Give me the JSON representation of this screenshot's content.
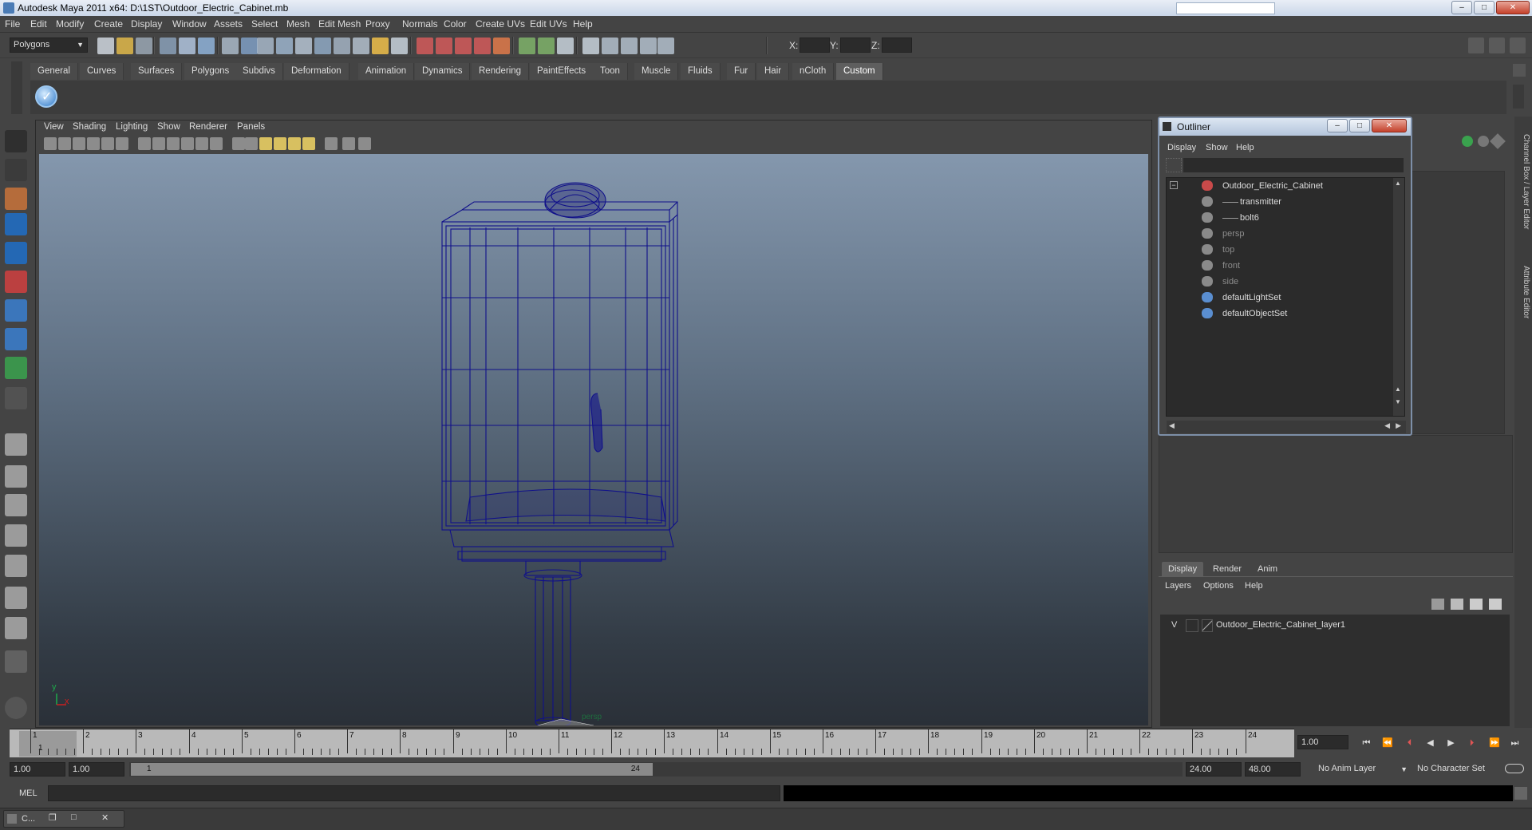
{
  "window": {
    "title": "Autodesk Maya 2011 x64: D:\\1ST\\Outdoor_Electric_Cabinet.mb",
    "minimize": "–",
    "maximize": "□",
    "close": "✕"
  },
  "menus": [
    "File",
    "Edit",
    "Modify",
    "Create",
    "Display",
    "Window",
    "Assets",
    "Select",
    "Mesh",
    "Edit Mesh",
    "Proxy",
    "Normals",
    "Color",
    "Create UVs",
    "Edit UVs",
    "Help"
  ],
  "toolbar": {
    "mode_select": "Polygons",
    "coord_x_label": "X:",
    "coord_y_label": "Y:",
    "coord_z_label": "Z:"
  },
  "shelf_tabs": [
    "General",
    "Curves",
    "Surfaces",
    "Polygons",
    "Subdivs",
    "Deformation",
    "Animation",
    "Dynamics",
    "Rendering",
    "PaintEffects",
    "Toon",
    "Muscle",
    "Fluids",
    "Fur",
    "Hair",
    "nCloth",
    "Custom"
  ],
  "shelf_active": "Custom",
  "viewport": {
    "menu": [
      "View",
      "Shading",
      "Lighting",
      "Show",
      "Renderer",
      "Panels"
    ],
    "camera_label": "persp",
    "axis_y": "y",
    "axis_x": "x"
  },
  "outliner": {
    "title": "Outliner",
    "menu": [
      "Display",
      "Show",
      "Help"
    ],
    "items": [
      {
        "label": "Outdoor_Electric_Cabinet",
        "dim": false,
        "icon": "mesh-group-icon"
      },
      {
        "label": "transmitter",
        "dim": false,
        "icon": "mesh-icon"
      },
      {
        "label": "bolt6",
        "dim": false,
        "icon": "mesh-icon"
      },
      {
        "label": "persp",
        "dim": true,
        "icon": "camera-icon"
      },
      {
        "label": "top",
        "dim": true,
        "icon": "camera-icon"
      },
      {
        "label": "front",
        "dim": true,
        "icon": "camera-icon"
      },
      {
        "label": "side",
        "dim": true,
        "icon": "camera-icon"
      },
      {
        "label": "defaultLightSet",
        "dim": false,
        "icon": "set-icon"
      },
      {
        "label": "defaultObjectSet",
        "dim": false,
        "icon": "set-icon"
      }
    ]
  },
  "side_tabs": [
    "Channel Box / Layer Editor",
    "Attribute Editor"
  ],
  "layer_editor": {
    "tabs": [
      "Display",
      "Render",
      "Anim"
    ],
    "active_tab": "Display",
    "menu": [
      "Layers",
      "Options",
      "Help"
    ],
    "layer_visibility": "V",
    "layer_name": "Outdoor_Electric_Cabinet_layer1"
  },
  "timeline": {
    "frames": [
      "1",
      "2",
      "3",
      "4",
      "5",
      "6",
      "7",
      "8",
      "9",
      "10",
      "11",
      "12",
      "13",
      "14",
      "15",
      "16",
      "17",
      "18",
      "19",
      "20",
      "21",
      "22",
      "23",
      "24"
    ],
    "current_frame_label": "1",
    "current_time": "1.00"
  },
  "range": {
    "start_time": "1.00",
    "playback_start": "1.00",
    "slider_start": "1",
    "slider_end": "24",
    "playback_end": "24.00",
    "end_time": "48.00",
    "anim_layer": "No Anim Layer",
    "character_set": "No Character Set"
  },
  "command": {
    "label": "MEL"
  },
  "taskbar": {
    "item_label": "C..."
  }
}
